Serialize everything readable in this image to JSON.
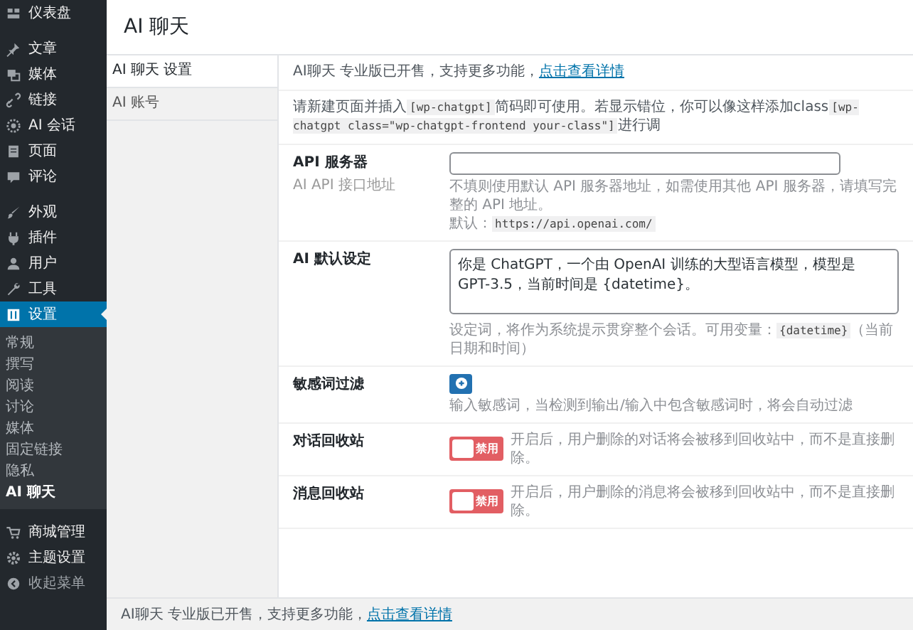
{
  "sidebar": {
    "groups": [
      [
        {
          "label": "仪表盘",
          "selected": false
        }
      ],
      [
        {
          "label": "文章",
          "selected": false
        },
        {
          "label": "媒体",
          "selected": false
        },
        {
          "label": "链接",
          "selected": false
        },
        {
          "label": "AI 会话",
          "selected": false
        },
        {
          "label": "页面",
          "selected": false
        },
        {
          "label": "评论",
          "selected": false
        }
      ],
      [
        {
          "label": "外观",
          "selected": false
        },
        {
          "label": "插件",
          "selected": false
        },
        {
          "label": "用户",
          "selected": false
        },
        {
          "label": "工具",
          "selected": false
        },
        {
          "label": "设置",
          "selected": true,
          "children": [
            {
              "label": "常规",
              "selected": false
            },
            {
              "label": "撰写",
              "selected": false
            },
            {
              "label": "阅读",
              "selected": false
            },
            {
              "label": "讨论",
              "selected": false
            },
            {
              "label": "媒体",
              "selected": false
            },
            {
              "label": "固定链接",
              "selected": false
            },
            {
              "label": "隐私",
              "selected": false
            },
            {
              "label": "AI 聊天",
              "selected": true
            }
          ]
        }
      ],
      [
        {
          "label": "商城管理",
          "selected": false
        },
        {
          "label": "主题设置",
          "selected": false
        },
        {
          "label": "收起菜单",
          "selected": false,
          "kind": "collapse"
        }
      ]
    ]
  },
  "header": {
    "title": "AI 聊天"
  },
  "tabs": [
    {
      "label": "AI 聊天 设置",
      "selected": true
    },
    {
      "label": "AI 账号",
      "selected": false
    }
  ],
  "notices": [
    [
      {
        "kind": "text",
        "text": "AI聊天 专业版已开售，支持更多功能，"
      },
      {
        "kind": "link",
        "text": "点击查看详情"
      }
    ],
    [
      {
        "kind": "text",
        "text": "请新建页面并插入"
      },
      {
        "kind": "code",
        "text": "[wp-chatgpt]"
      },
      {
        "kind": "text",
        "text": "简码即可使用。若显示错位，你可以像这样添加class"
      },
      {
        "kind": "code",
        "text": "[wp-chatgpt class=\"wp-chatgpt-frontend your-class\"]"
      },
      {
        "kind": "text",
        "text": "进行调"
      }
    ]
  ],
  "fields": [
    {
      "kind": "text",
      "label": "API 服务器",
      "sublabel": "AI API 接口地址",
      "description": [
        {
          "kind": "text",
          "text": "不填则使用默认 API 服务器地址，如需使用其他 API 服务器，请填写完整的 API 地址。"
        },
        {
          "kind": "break"
        },
        {
          "kind": "text",
          "text": "默认："
        },
        {
          "kind": "code",
          "text": "https://api.openai.com/"
        }
      ]
    },
    {
      "kind": "textarea",
      "label": "AI 默认设定",
      "value": "你是 ChatGPT，一个由 OpenAI 训练的大型语言模型，模型是 GPT-3.5，当前时间是 {datetime}。",
      "description": [
        {
          "kind": "text",
          "text": "设定词，将作为系统提示贯穿整个会话。可用变量："
        },
        {
          "kind": "code",
          "text": "{datetime}"
        },
        {
          "kind": "text",
          "text": "（当前日期和时间）"
        }
      ]
    },
    {
      "kind": "add",
      "label": "敏感词过滤",
      "description": [
        {
          "kind": "text",
          "text": "输入敏感词，当检测到输出/输入中包含敏感词时，将会自动过滤"
        }
      ]
    },
    {
      "kind": "toggle",
      "label": "对话回收站",
      "on": false,
      "toggle_label": "禁用",
      "description": [
        {
          "kind": "text",
          "text": "开启后，用户删除的对话将会被移到回收站中，而不是直接删除。"
        }
      ]
    },
    {
      "kind": "toggle",
      "label": "消息回收站",
      "on": false,
      "toggle_label": "禁用",
      "description": [
        {
          "kind": "text",
          "text": "开启后，用户删除的消息将会被移到回收站中，而不是直接删除。"
        }
      ]
    }
  ],
  "footer": [
    {
      "kind": "text",
      "text": "AI聊天 专业版已开售，支持更多功能，"
    },
    {
      "kind": "link",
      "text": "点击查看详情"
    }
  ]
}
